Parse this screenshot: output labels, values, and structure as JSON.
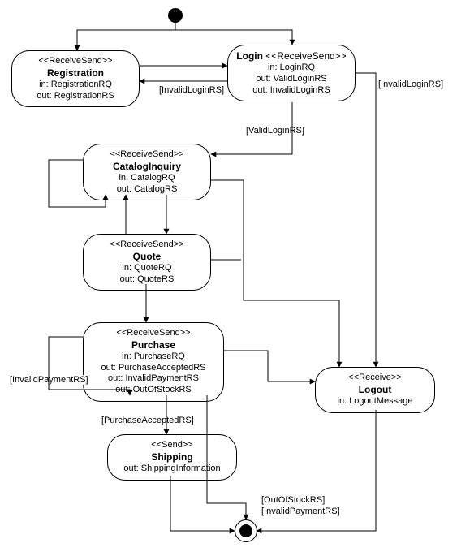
{
  "chart_data": {
    "type": "activity-diagram",
    "title": "",
    "start": true,
    "end": true,
    "nodes": [
      {
        "id": "registration",
        "stereotype": "<<ReceiveSend>>",
        "name": "Registration",
        "io": [
          "in: RegistrationRQ",
          "out: RegistrationRS"
        ]
      },
      {
        "id": "login",
        "stereotype": "<<ReceiveSend>>",
        "name": "Login",
        "io": [
          "in: LoginRQ",
          "out: ValidLoginRS",
          "out: InvalidLoginRS"
        ],
        "stereoInline": true,
        "stereoLabel": "Login <<ReceiveSend>>"
      },
      {
        "id": "catalog",
        "stereotype": "<<ReceiveSend>>",
        "name": "CatalogInquiry",
        "io": [
          "in: CatalogRQ",
          "out: CatalogRS"
        ]
      },
      {
        "id": "quote",
        "stereotype": "<<ReceiveSend>>",
        "name": "Quote",
        "io": [
          "in: QuoteRQ",
          "out: QuoteRS"
        ]
      },
      {
        "id": "purchase",
        "stereotype": "<<ReceiveSend>>",
        "name": "Purchase",
        "io": [
          "in: PurchaseRQ",
          "out: PurchaseAcceptedRS",
          "out: InvalidPaymentRS",
          "out: OutOfStockRS"
        ]
      },
      {
        "id": "shipping",
        "stereotype": "<<Send>>",
        "name": "Shipping",
        "io": [
          "out: ShippingInformation"
        ]
      },
      {
        "id": "logout",
        "stereotype": "<<Receive>>",
        "name": "Logout",
        "io": [
          "in: LogoutMessage"
        ]
      }
    ],
    "edges": [
      {
        "from": "start",
        "to": "registration",
        "guard": ""
      },
      {
        "from": "start",
        "to": "login",
        "guard": ""
      },
      {
        "from": "registration",
        "to": "login",
        "guard": ""
      },
      {
        "from": "login",
        "to": "registration",
        "guard": "[InvalidLoginRS]"
      },
      {
        "from": "login",
        "to": "logout",
        "guard": "[InvalidLoginRS]"
      },
      {
        "from": "login",
        "to": "catalog",
        "guard": "[ValidLoginRS]"
      },
      {
        "from": "catalog",
        "to": "catalog",
        "guard": ""
      },
      {
        "from": "catalog",
        "to": "quote",
        "guard": ""
      },
      {
        "from": "catalog",
        "to": "logout",
        "guard": ""
      },
      {
        "from": "quote",
        "to": "catalog",
        "guard": ""
      },
      {
        "from": "quote",
        "to": "purchase",
        "guard": ""
      },
      {
        "from": "quote",
        "to": "logout",
        "guard": ""
      },
      {
        "from": "purchase",
        "to": "purchase",
        "guard": "[InvalidPaymentRS]"
      },
      {
        "from": "purchase",
        "to": "shipping",
        "guard": "[PurchaseAcceptedRS]"
      },
      {
        "from": "purchase",
        "to": "logout",
        "guard": ""
      },
      {
        "from": "purchase",
        "to": "end",
        "guard": "[OutOfStockRS]"
      },
      {
        "from": "purchase",
        "to": "end",
        "guard": "[InvalidPaymentRS]"
      },
      {
        "from": "shipping",
        "to": "end",
        "guard": ""
      },
      {
        "from": "logout",
        "to": "end",
        "guard": ""
      }
    ]
  },
  "labels": {
    "invalidLoginRS": "[InvalidLoginRS]",
    "validLoginRS": "[ValidLoginRS]",
    "invalidPaymentRS": "[InvalidPaymentRS]",
    "purchaseAcceptedRS": "[PurchaseAcceptedRS]",
    "outOfStockRS": "[OutOfStockRS]"
  }
}
